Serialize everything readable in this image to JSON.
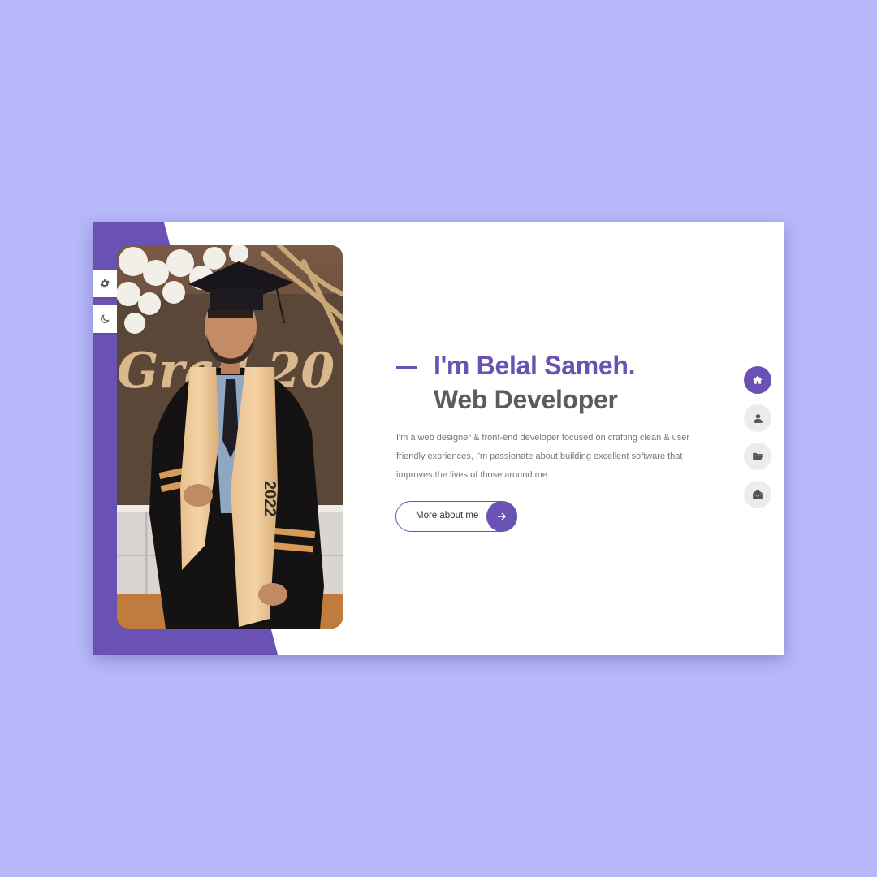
{
  "hero": {
    "name": "I'm Belal Sameh.",
    "role": "Web Developer",
    "description": "I'm a web designer & front-end developer focused on crafting clean & user friendly expriences, I'm passionate about building excellent software that improves the lives of those around me.",
    "cta_label": "More about me"
  },
  "photo": {
    "stole_text": "2022",
    "backdrop_text": "Grad 20"
  },
  "left_toggles": [
    {
      "icon": "gear-icon"
    },
    {
      "icon": "moon-icon"
    }
  ],
  "side_nav": [
    {
      "icon": "home-icon",
      "active": true
    },
    {
      "icon": "user-icon",
      "active": false
    },
    {
      "icon": "folder-icon",
      "active": false
    },
    {
      "icon": "envelope-icon",
      "active": false
    }
  ],
  "colors": {
    "background": "#b6b8fb",
    "accent": "#6a52b5",
    "heading_gray": "#5c5c5c",
    "text_gray": "#777777",
    "nav_inactive": "#ececec"
  }
}
